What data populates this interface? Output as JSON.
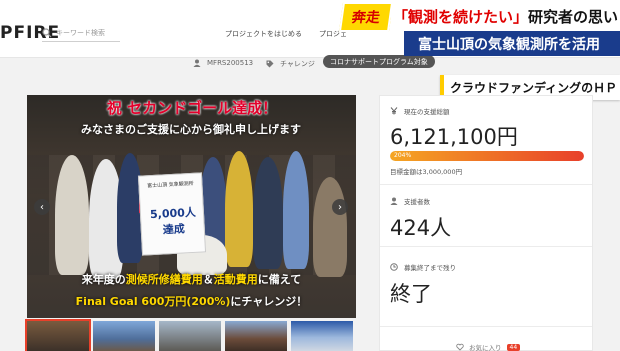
{
  "header": {
    "logo": "PFIRE",
    "search_placeholder": "キーワード検索",
    "nav": [
      "プロジェクトをはじめる",
      "プロジェ"
    ]
  },
  "meta": {
    "owner": "MFRS200513",
    "category": "チャレンジ",
    "tag": "コロナサポートプログラム対象"
  },
  "tv_caption": {
    "runner": "奔走",
    "quote_red": "「観測を続けたい」",
    "quote_black": "研究者の思い",
    "sub": "富士山頂の気象観測所を活用",
    "hp_label": "クラウドファンディングのＨＰ"
  },
  "hero": {
    "headline": "祝 セカンドゴール達成！",
    "thanks": "みなさまのご支援に心から御礼申し上げます",
    "sign_title": "富士山頂 気象観測所",
    "sign_number": "5,000人達成",
    "bottom1_white1": "来年度の",
    "bottom1_yellow1": "測候所修繕費用",
    "bottom1_white2": "＆",
    "bottom1_yellow2": "活動費用",
    "bottom1_white3": "に備えて",
    "bottom2_yellow": "Final Goal 600万円(200%)",
    "bottom2_white": "にチャレンジ！",
    "prev": "‹",
    "next": "›"
  },
  "panel": {
    "raised_label": "現在の支援総額",
    "raised_amount": "6,121,100円",
    "progress_percent": 204,
    "progress_label": "204%",
    "goal_text": "目標金額は3,000,000円",
    "supporters_label": "支援者数",
    "supporters_value": "424人",
    "remaining_label": "募集終了まで残り",
    "remaining_value": "終了",
    "favorite_label": "お気に入り",
    "favorite_count": "44"
  },
  "colors": {
    "brand_red": "#e8402a",
    "caption_blue": "#1a3c8c",
    "caption_yellow": "#ffd800"
  }
}
